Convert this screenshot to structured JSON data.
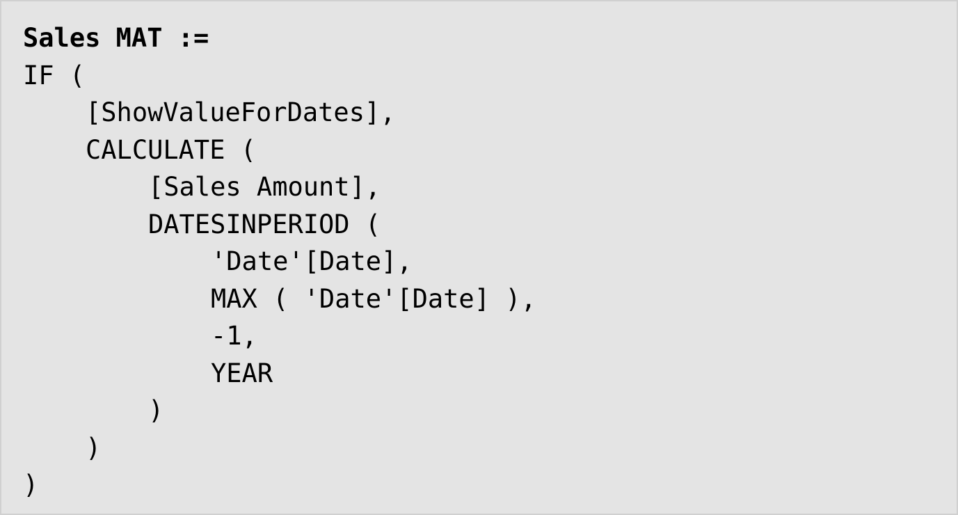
{
  "code": {
    "lines": [
      "Sales MAT :=",
      "IF (",
      "[ShowValueForDates],",
      "CALCULATE (",
      "[Sales Amount],",
      "DATESINPERIOD (",
      "'Date'[Date],",
      "MAX ( 'Date'[Date] ),",
      "-1,",
      "YEAR",
      ")",
      ")",
      ")"
    ]
  },
  "colors": {
    "background": "#e4e4e4",
    "border": "#d0d0d0",
    "text": "#000000"
  }
}
